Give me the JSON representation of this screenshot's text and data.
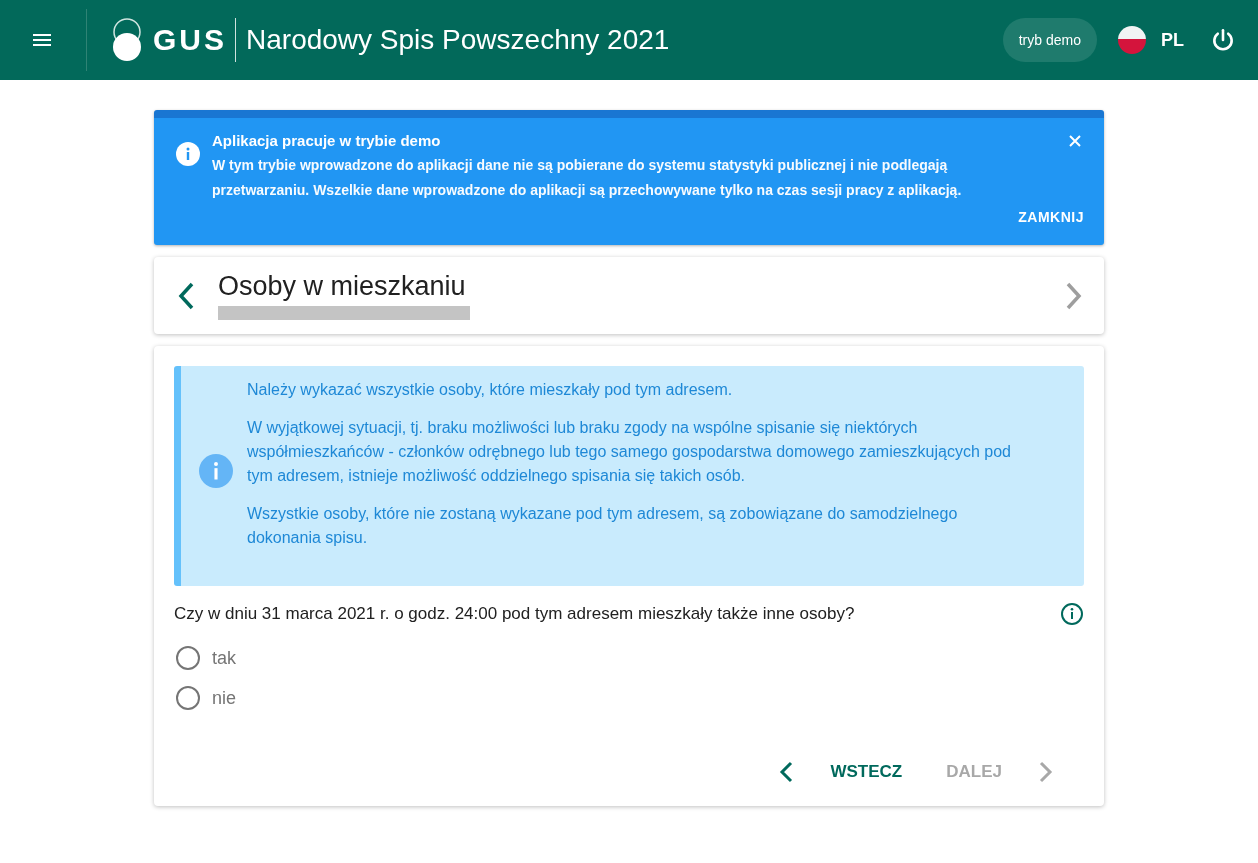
{
  "header": {
    "logo_text": "GUS",
    "title": "Narodowy Spis Powszechny 2021",
    "demo_badge": "tryb demo",
    "language": "PL"
  },
  "alert": {
    "title": "Aplikacja pracuje w trybie demo",
    "message": "W tym trybie wprowadzone do aplikacji dane nie są pobierane do systemu statystyki publicznej i nie podlegają przetwarzaniu. Wszelkie dane wprowadzone do aplikacji są przechowywane tylko na czas sesji pracy z aplikacją.",
    "close_label": "ZAMKNIJ"
  },
  "section": {
    "title": "Osoby w mieszkaniu",
    "next_disabled": true
  },
  "info_box": {
    "paragraphs": [
      "Należy wykazać wszystkie osoby, które mieszkały pod tym adresem.",
      "W wyjątkowej sytuacji, tj. braku możliwości lub braku zgody na wspólne spisanie się niektórych współmieszkańców - członków odrębnego lub tego samego gospodarstwa domowego zamieszkujących pod tym adresem, istnieje możliwość oddzielnego spisania się takich osób.",
      "Wszystkie osoby, które nie zostaną wykazane pod tym adresem, są zobowiązane do samodzielnego dokonania spisu."
    ]
  },
  "question": {
    "text": "Czy w dniu 31 marca 2021 r. o godz. 24:00 pod tym adresem mieszkały także inne osoby?",
    "options": [
      {
        "label": "tak",
        "selected": false
      },
      {
        "label": "nie",
        "selected": false
      }
    ]
  },
  "navigation": {
    "back": {
      "label": "WSTECZ",
      "disabled": false
    },
    "next": {
      "label": "DALEJ",
      "disabled": true
    }
  }
}
